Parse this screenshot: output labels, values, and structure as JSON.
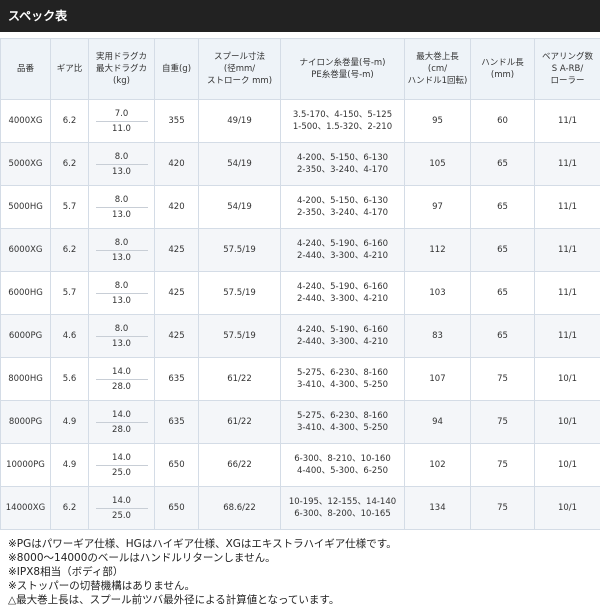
{
  "title": "スペック表",
  "headers": [
    "品番",
    "ギア比",
    "実用ドラグカ\n最大ドラグカ\n(kg)",
    "自重(g)",
    "スプール寸法\n(径mm/\nストローク mm)",
    "ナイロン糸巻量(号-m)\nPE糸巻量(号-m)",
    "最大巻上長\n(cm/\nハンドル1回転)",
    "ハンドル長\n(mm)",
    "ベアリング数\nS A-RB/\nローラー"
  ],
  "rows": [
    {
      "model": "4000XG",
      "gear": "6.2",
      "drag_practical": "7.0",
      "drag_max": "11.0",
      "weight": "355",
      "spool": "49/19",
      "nylon": "3.5-170、4-150、5-125",
      "pe": "1-500、1.5-320、2-210",
      "retrieve": "95",
      "handle": "60",
      "bearing": "11/1"
    },
    {
      "model": "5000XG",
      "gear": "6.2",
      "drag_practical": "8.0",
      "drag_max": "13.0",
      "weight": "420",
      "spool": "54/19",
      "nylon": "4-200、5-150、6-130",
      "pe": "2-350、3-240、4-170",
      "retrieve": "105",
      "handle": "65",
      "bearing": "11/1"
    },
    {
      "model": "5000HG",
      "gear": "5.7",
      "drag_practical": "8.0",
      "drag_max": "13.0",
      "weight": "420",
      "spool": "54/19",
      "nylon": "4-200、5-150、6-130",
      "pe": "2-350、3-240、4-170",
      "retrieve": "97",
      "handle": "65",
      "bearing": "11/1"
    },
    {
      "model": "6000XG",
      "gear": "6.2",
      "drag_practical": "8.0",
      "drag_max": "13.0",
      "weight": "425",
      "spool": "57.5/19",
      "nylon": "4-240、5-190、6-160",
      "pe": "2-440、3-300、4-210",
      "retrieve": "112",
      "handle": "65",
      "bearing": "11/1"
    },
    {
      "model": "6000HG",
      "gear": "5.7",
      "drag_practical": "8.0",
      "drag_max": "13.0",
      "weight": "425",
      "spool": "57.5/19",
      "nylon": "4-240、5-190、6-160",
      "pe": "2-440、3-300、4-210",
      "retrieve": "103",
      "handle": "65",
      "bearing": "11/1"
    },
    {
      "model": "6000PG",
      "gear": "4.6",
      "drag_practical": "8.0",
      "drag_max": "13.0",
      "weight": "425",
      "spool": "57.5/19",
      "nylon": "4-240、5-190、6-160",
      "pe": "2-440、3-300、4-210",
      "retrieve": "83",
      "handle": "65",
      "bearing": "11/1"
    },
    {
      "model": "8000HG",
      "gear": "5.6",
      "drag_practical": "14.0",
      "drag_max": "28.0",
      "weight": "635",
      "spool": "61/22",
      "nylon": "5-275、6-230、8-160",
      "pe": "3-410、4-300、5-250",
      "retrieve": "107",
      "handle": "75",
      "bearing": "10/1"
    },
    {
      "model": "8000PG",
      "gear": "4.9",
      "drag_practical": "14.0",
      "drag_max": "28.0",
      "weight": "635",
      "spool": "61/22",
      "nylon": "5-275、6-230、8-160",
      "pe": "3-410、4-300、5-250",
      "retrieve": "94",
      "handle": "75",
      "bearing": "10/1"
    },
    {
      "model": "10000PG",
      "gear": "4.9",
      "drag_practical": "14.0",
      "drag_max": "25.0",
      "weight": "650",
      "spool": "66/22",
      "nylon": "6-300、8-210、10-160",
      "pe": "4-400、5-300、6-250",
      "retrieve": "102",
      "handle": "75",
      "bearing": "10/1"
    },
    {
      "model": "14000XG",
      "gear": "6.2",
      "drag_practical": "14.0",
      "drag_max": "25.0",
      "weight": "650",
      "spool": "68.6/22",
      "nylon": "10-195、12-155、14-140",
      "pe": "6-300、8-200、10-165",
      "retrieve": "134",
      "handle": "75",
      "bearing": "10/1"
    }
  ],
  "notes": [
    "※PGはパワーギア仕様、HGはハイギア仕様、XGはエキストラハイギア仕様です。",
    "※8000～14000のベールはハンドルリターンしません。",
    "※IPX8相当（ボディ部）",
    "※ストッパーの切替機構はありません。",
    "△最大巻上長は、スプール前ツバ最外径による計算値となっています。"
  ]
}
